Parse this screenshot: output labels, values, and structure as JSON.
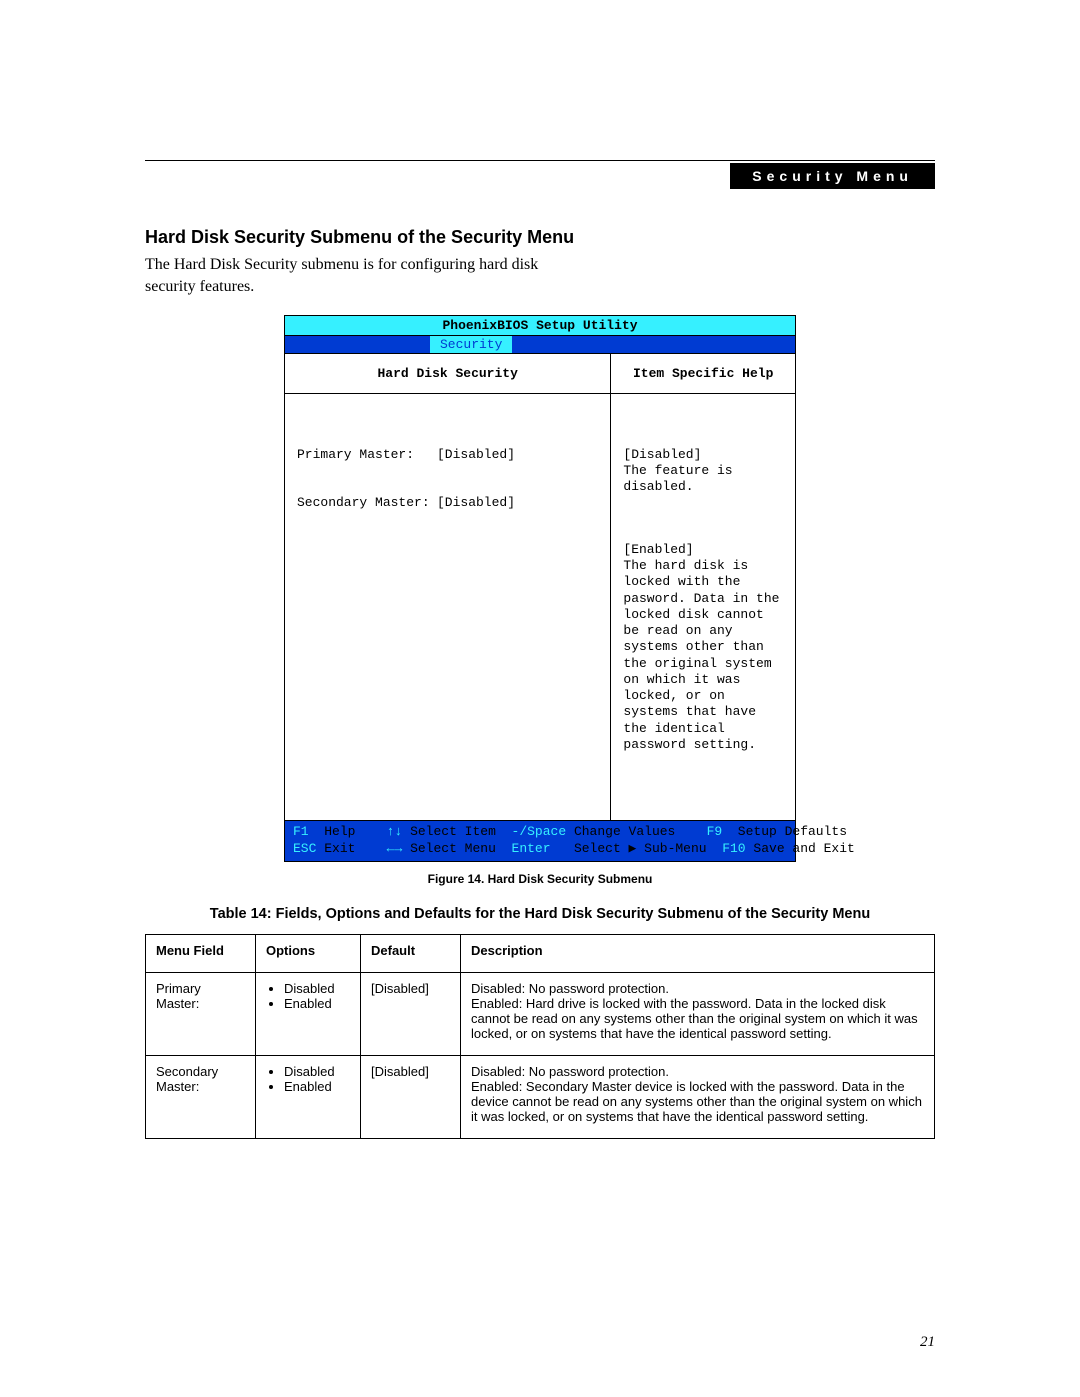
{
  "header": {
    "tag": "Security Menu"
  },
  "section": {
    "title": "Hard Disk Security Submenu of the Security Menu",
    "intro": "The Hard Disk Security submenu is for configuring hard disk security features."
  },
  "bios": {
    "title": "PhoenixBIOS Setup Utility",
    "active_tab": "Security",
    "left_header": "Hard Disk Security",
    "right_header": "Item Specific Help",
    "fields": [
      {
        "label": "Primary Master:",
        "value": "[Disabled]"
      },
      {
        "label": "Secondary Master:",
        "value": "[Disabled]"
      }
    ],
    "help": {
      "p1": "[Disabled]\nThe feature is disabled.",
      "p2": "[Enabled]\nThe hard disk is locked with the pasword. Data in the locked disk cannot be read on any systems other than the original system on which it was locked, or on systems that have the identical password setting."
    },
    "footer": {
      "row1": {
        "k1": "F1",
        "a1": "Help",
        "k2": "↑↓",
        "a2": "Select Item",
        "k3": "-/Space",
        "a3": "Change Values",
        "k4": "F9",
        "a4": "Setup Defaults"
      },
      "row2": {
        "k1": "ESC",
        "a1": "Exit",
        "k2": "←→",
        "a2": "Select Menu",
        "k3": "Enter",
        "a3": "Select ▶ Sub-Menu",
        "k4": "F10",
        "a4": "Save and Exit"
      }
    }
  },
  "figure_caption": "Figure 14.   Hard Disk Security Submenu",
  "table_caption": "Table 14: Fields, Options and Defaults for the Hard Disk Security Submenu of the Security Menu",
  "table": {
    "headers": {
      "menu": "Menu Field",
      "options": "Options",
      "default": "Default",
      "desc": "Description"
    },
    "rows": [
      {
        "menu": "Primary Master:",
        "options": [
          "Disabled",
          "Enabled"
        ],
        "default": "[Disabled]",
        "desc": "Disabled: No password protection.\nEnabled: Hard drive is locked with the password. Data in the locked disk cannot be read on any systems other than the original system on which it was locked, or on systems that have the identical password setting."
      },
      {
        "menu": "Secondary Master:",
        "options": [
          "Disabled",
          "Enabled"
        ],
        "default": "[Disabled]",
        "desc": "Disabled: No password protection.\nEnabled: Secondary Master device is locked with the password. Data in the device cannot be read on any systems other than the original system on which it was locked, or on systems that have the identical password setting."
      }
    ]
  },
  "page_number": "21"
}
